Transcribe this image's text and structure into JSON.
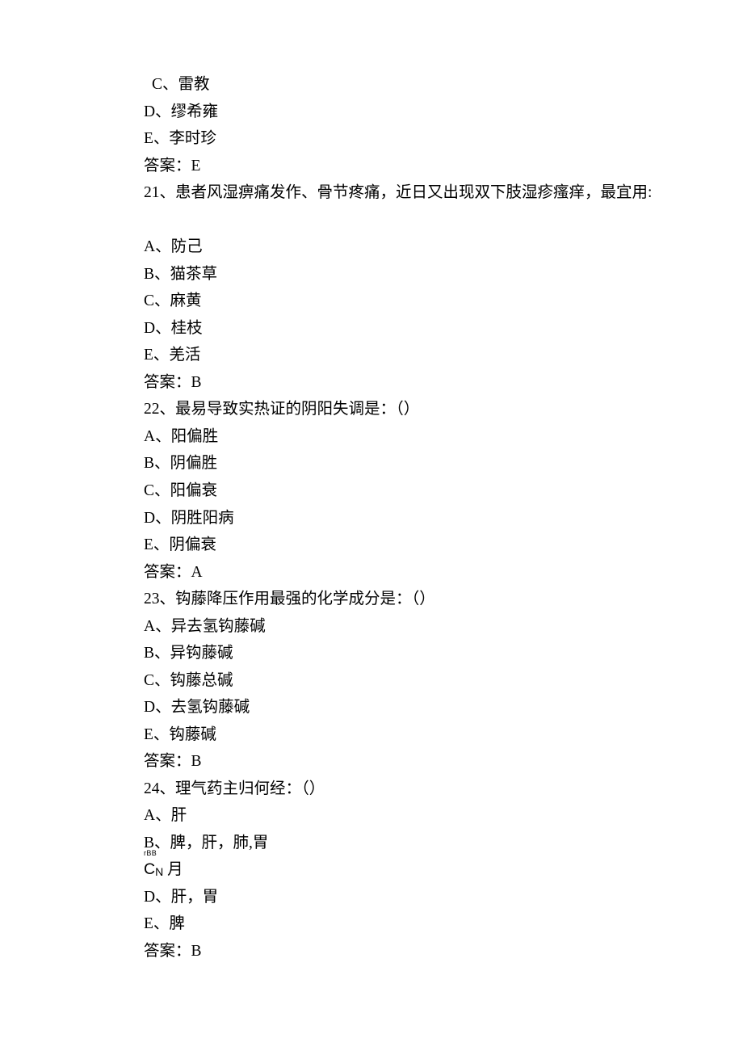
{
  "lines": {
    "l01": " C、雷教",
    "l02": "D、缪希雍",
    "l03": "E、李时珍",
    "l04": "答案：E",
    "l05": "21、患者风湿痹痛发作、骨节疼痛，近日又出现双下肢湿疹瘙痒，最宜用:",
    "l06": "A、防己",
    "l07": "B、猫茶草",
    "l08": "C、麻黄",
    "l09": "D、桂枝",
    "l10": "E、羌活",
    "l11": "答案：B",
    "l12": "22、最易导致实热证的阴阳失调是：（）",
    "l13": "A、阳偏胜",
    "l14": "B、阴偏胜",
    "l15": "C、阳偏衰",
    "l16": "D、阴胜阳病",
    "l17": "E、阴偏衰",
    "l18": "答案：A",
    "l19": "23、钩藤降压作用最强的化学成分是：（）",
    "l20": "A、异去氢钩藤碱",
    "l21": "B、异钩藤碱",
    "l22": "C、钩藤总碱",
    "l23": "D、去氢钩藤碱",
    "l24": "E、钩藤碱",
    "l25": "答案：B",
    "l26": "24、理气药主归何经：（）",
    "l27": "A、肝",
    "l28": "B、脾，肝，肺,胃",
    "l29_ruby_top": "rBB",
    "l29_ruby_base": "C",
    "l29_ruby_sub": "N",
    "l29_tail": " 月",
    "l30": "D、肝，胃",
    "l31": "E、脾",
    "l32": "答案：B"
  }
}
